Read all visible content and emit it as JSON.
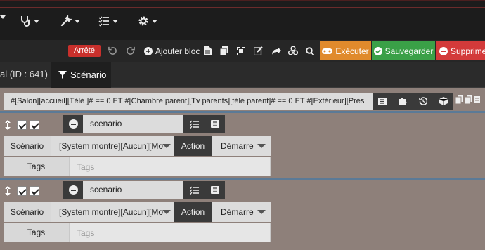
{
  "nav": {
    "items": [
      {
        "icon": "stethoscope-icon"
      },
      {
        "icon": "wrench-icon"
      },
      {
        "icon": "list-check-icon"
      },
      {
        "icon": "gear-icon"
      }
    ]
  },
  "toolbar": {
    "status_badge": "Arrêté",
    "add_block_label": "Ajouter bloc",
    "execute_label": "Exécuter",
    "save_label": "Sauvegarder",
    "delete_label": "Supprimer"
  },
  "tabs": {
    "general_label": "al (ID : 641)",
    "scenario_label": "Scénario"
  },
  "condition": {
    "text": "#[Salon][accueil][Télé ]# == 0 ET #[Chambre parent][Tv parents][télé parent]# == 0 ET #[Extérieur][Prés"
  },
  "blocks": [
    {
      "name_value": "scenario",
      "scenario_label": "Scénario",
      "scenario_value": "[System montre][Aucun][Mo",
      "action_label": "Action",
      "action_value": "Démarre",
      "tags_label": "Tags",
      "tags_placeholder": "Tags"
    },
    {
      "name_value": "scenario",
      "scenario_label": "Scénario",
      "scenario_value": "[System montre][Aucun][Mo",
      "action_label": "Action",
      "action_value": "Démarre",
      "tags_label": "Tags",
      "tags_placeholder": "Tags"
    }
  ],
  "colors": {
    "execute": "#e08a2c",
    "save": "#3aa047",
    "delete": "#d33a3a",
    "stopped": "#c9302c",
    "canvas": "#8e807a"
  }
}
